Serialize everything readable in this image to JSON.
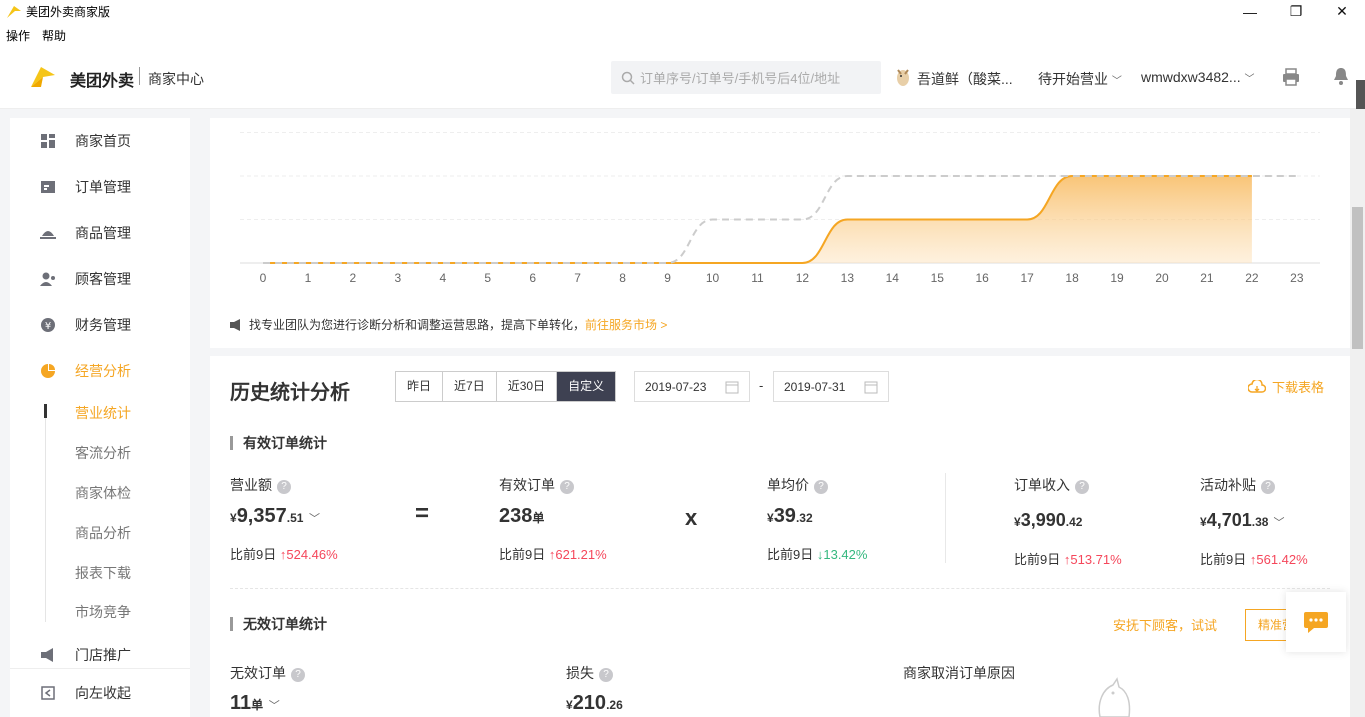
{
  "window": {
    "title": "美团外卖商家版",
    "minimize": "—",
    "maximize": "❐",
    "close": "✕"
  },
  "menu": [
    "操作",
    "帮助"
  ],
  "header": {
    "brand": "美团外卖",
    "brand_sub": "商家中心",
    "search_placeholder": "订单序号/订单号/手机号后4位/地址",
    "shop_name": "吾道鲜（酸菜...",
    "status": "待开始营业",
    "account": "wmwdxw3482..."
  },
  "sidebar": {
    "items": [
      {
        "label": "商家首页",
        "icon": "dashboard-icon"
      },
      {
        "label": "订单管理",
        "icon": "order-icon"
      },
      {
        "label": "商品管理",
        "icon": "product-icon"
      },
      {
        "label": "顾客管理",
        "icon": "customer-icon"
      },
      {
        "label": "财务管理",
        "icon": "yuan-icon"
      },
      {
        "label": "经营分析",
        "icon": "pie-chart-icon"
      }
    ],
    "sub_items": [
      "营业统计",
      "客流分析",
      "商家体检",
      "商品分析",
      "报表下载",
      "市场竞争"
    ],
    "promo": "门店推广",
    "collapse": "向左收起"
  },
  "chart_data": {
    "type": "line",
    "x": [
      0,
      1,
      2,
      3,
      4,
      5,
      6,
      7,
      8,
      9,
      10,
      11,
      12,
      13,
      14,
      15,
      16,
      17,
      18,
      19,
      20,
      21,
      22,
      23
    ],
    "xticks": [
      "0",
      "1",
      "2",
      "3",
      "4",
      "5",
      "6",
      "7",
      "8",
      "9",
      "10",
      "11",
      "12",
      "13",
      "14",
      "15",
      "16",
      "17",
      "18",
      "19",
      "20",
      "21",
      "22",
      "23"
    ],
    "series": [
      {
        "style": "area-solid",
        "color": "#f5a623",
        "values": [
          0,
          0,
          0,
          0,
          0,
          0,
          0,
          0,
          0,
          0,
          0,
          0,
          0,
          1,
          1,
          1,
          1,
          1,
          2,
          2,
          2,
          2,
          2,
          null
        ]
      },
      {
        "style": "dashed",
        "color": "#cccccc",
        "values": [
          0,
          0,
          0,
          0,
          0,
          0,
          0,
          0,
          0,
          0,
          1,
          1,
          1,
          2,
          2,
          2,
          2,
          2,
          2,
          2,
          2,
          2,
          2,
          2
        ]
      }
    ],
    "grid": true
  },
  "tip": {
    "text": "找专业团队为您进行诊断分析和调整运营思路，提高下单转化，",
    "link": "前往服务市场 >"
  },
  "history": {
    "title": "历史统计分析",
    "ranges": [
      "昨日",
      "近7日",
      "近30日",
      "自定义"
    ],
    "date_from": "2019-07-23",
    "date_sep": "-",
    "date_to": "2019-07-31",
    "download": "下载表格"
  },
  "valid": {
    "title": "有效订单统计",
    "revenue": {
      "label": "营业额",
      "currency": "¥",
      "int": "9,357",
      "dec": ".51",
      "cmp_label": "比前9日",
      "cmp": "524.46%"
    },
    "eq": "=",
    "orders": {
      "label": "有效订单",
      "int": "238",
      "unit": "单",
      "cmp_label": "比前9日",
      "cmp": "621.21%"
    },
    "x": "x",
    "avg": {
      "label": "单均价",
      "currency": "¥",
      "int": "39",
      "dec": ".32",
      "cmp_label": "比前9日",
      "cmp": "13.42%"
    },
    "income": {
      "label": "订单收入",
      "currency": "¥",
      "int": "3,990",
      "dec": ".42",
      "cmp_label": "比前9日",
      "cmp": "513.71%"
    },
    "subsidy": {
      "label": "活动补贴",
      "currency": "¥",
      "int": "4,701",
      "dec": ".38",
      "cmp_label": "比前9日",
      "cmp": "561.42%"
    }
  },
  "invalid": {
    "title": "无效订单统计",
    "promo_text": "安抚下顾客，试试",
    "promo_btn": "精准营",
    "count": {
      "label": "无效订单",
      "int": "11",
      "unit": "单"
    },
    "loss": {
      "label": "损失",
      "currency": "¥",
      "int": "210",
      "dec": ".26"
    },
    "reason": {
      "label": "商家取消订单原因"
    }
  },
  "colors": {
    "accent": "#f5a623",
    "up": "#f5475b",
    "down": "#35b87f"
  }
}
